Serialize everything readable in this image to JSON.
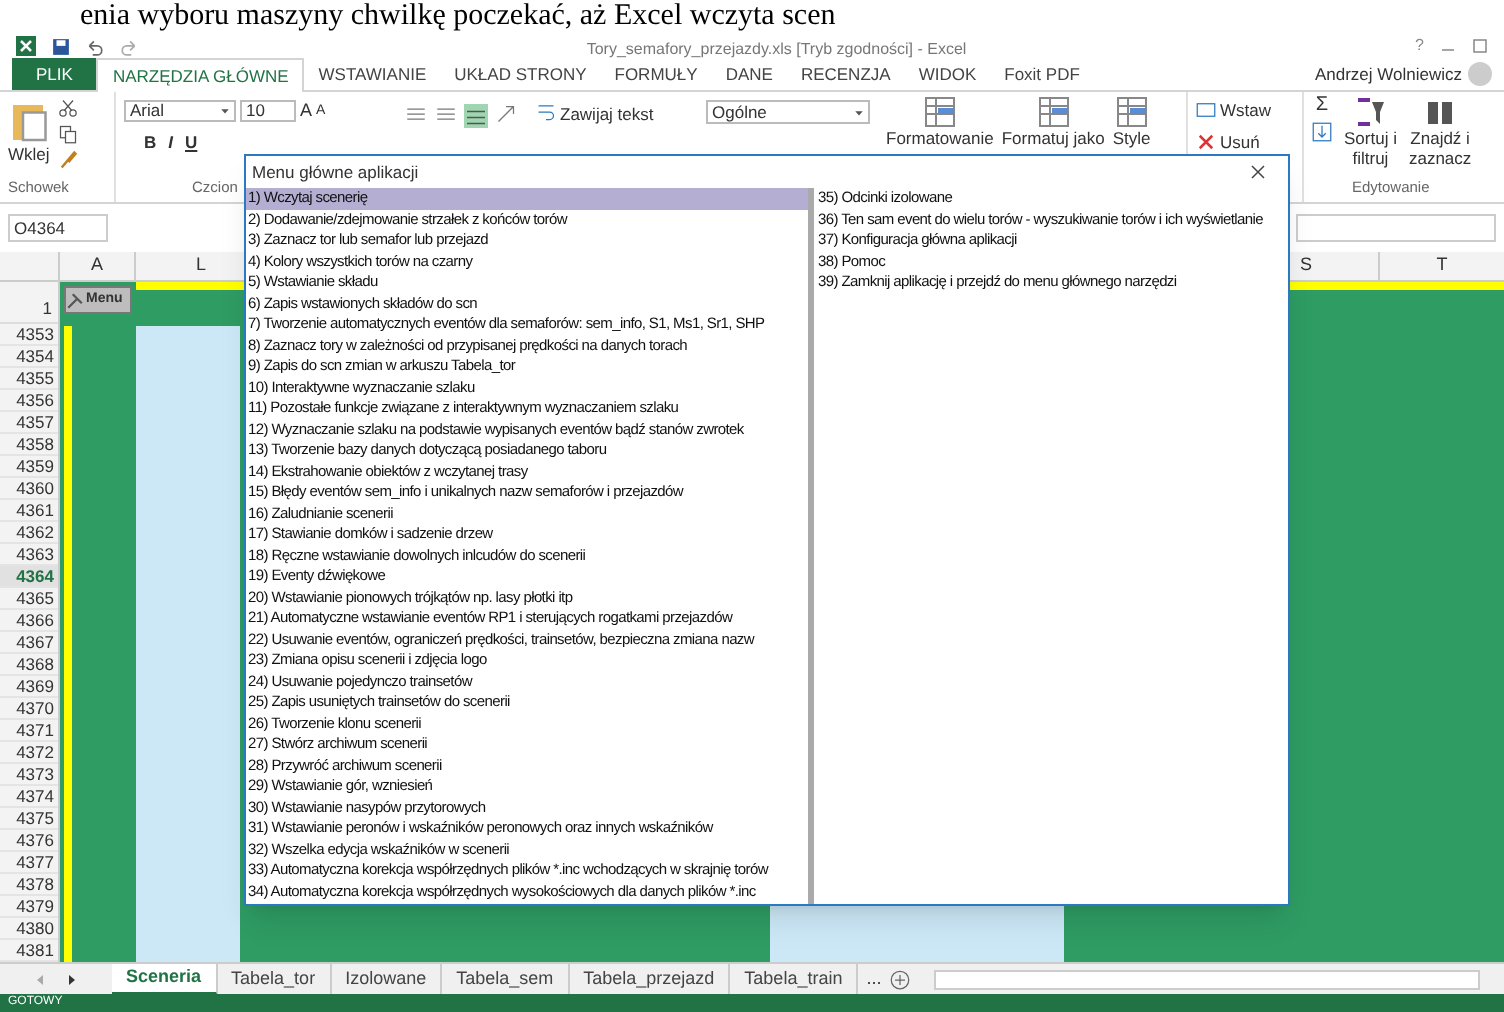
{
  "caption": "enia wyboru maszyny chwilkę poczekać, aż Excel wczyta scen",
  "window": {
    "title": "Tory_semafory_przejazdy.xls  [Tryb zgodności] - Excel",
    "user": "Andrzej Wolniewicz",
    "help": "?"
  },
  "ribbon_tabs": [
    {
      "label": "PLIK",
      "kind": "file",
      "selected": false
    },
    {
      "label": "NARZĘDZIA GŁÓWNE",
      "kind": "tab",
      "selected": true
    },
    {
      "label": "WSTAWIANIE",
      "kind": "tab",
      "selected": false
    },
    {
      "label": "UKŁAD STRONY",
      "kind": "tab",
      "selected": false
    },
    {
      "label": "FORMUŁY",
      "kind": "tab",
      "selected": false
    },
    {
      "label": "DANE",
      "kind": "tab",
      "selected": false
    },
    {
      "label": "RECENZJA",
      "kind": "tab",
      "selected": false
    },
    {
      "label": "WIDOK",
      "kind": "tab",
      "selected": false
    },
    {
      "label": "Foxit PDF",
      "kind": "tab",
      "selected": false
    }
  ],
  "ribbon": {
    "paste": "Wklej",
    "font_name": "Arial",
    "font_size": "10",
    "grow_font": "A",
    "shrink_font": "A",
    "sum": "Σ",
    "bold": "B",
    "italic": "I",
    "underline": "U",
    "wrap_text": "Zawijaj tekst",
    "number_format": "Ogólne",
    "styles": [
      "Formatowanie",
      "Formatuj jako",
      "Style"
    ],
    "insert": "Wstaw",
    "delete": "Usuń",
    "sort": [
      "Sortuj i",
      "filtruj"
    ],
    "find": [
      "Znajdź i",
      "zaznacz"
    ],
    "groups": [
      "Schowek",
      "Czcion",
      "Edytowanie"
    ]
  },
  "name_box": "O4364",
  "columns": [
    "A",
    "L",
    "S",
    "T"
  ],
  "menu_button": "Menu",
  "header_row": "1",
  "rows": [
    {
      "label": "4353",
      "selected": false
    },
    {
      "label": "4354",
      "selected": false
    },
    {
      "label": "4355",
      "selected": false
    },
    {
      "label": "4356",
      "selected": false
    },
    {
      "label": "4357",
      "selected": false
    },
    {
      "label": "4358",
      "selected": false
    },
    {
      "label": "4359",
      "selected": false
    },
    {
      "label": "4360",
      "selected": false
    },
    {
      "label": "4361",
      "selected": false
    },
    {
      "label": "4362",
      "selected": false
    },
    {
      "label": "4363",
      "selected": false
    },
    {
      "label": "4364",
      "selected": true
    },
    {
      "label": "4365",
      "selected": false
    },
    {
      "label": "4366",
      "selected": false
    },
    {
      "label": "4367",
      "selected": false
    },
    {
      "label": "4368",
      "selected": false
    },
    {
      "label": "4369",
      "selected": false
    },
    {
      "label": "4370",
      "selected": false
    },
    {
      "label": "4371",
      "selected": false
    },
    {
      "label": "4372",
      "selected": false
    },
    {
      "label": "4373",
      "selected": false
    },
    {
      "label": "4374",
      "selected": false
    },
    {
      "label": "4375",
      "selected": false
    },
    {
      "label": "4376",
      "selected": false
    },
    {
      "label": "4377",
      "selected": false
    },
    {
      "label": "4378",
      "selected": false
    },
    {
      "label": "4379",
      "selected": false
    },
    {
      "label": "4380",
      "selected": false
    },
    {
      "label": "4381",
      "selected": false
    }
  ],
  "dialog": {
    "title": "Menu główne aplikacji",
    "left_items": [
      {
        "label": "1) Wczytaj scenerię",
        "selected": true
      },
      {
        "label": "2) Dodawanie/zdejmowanie strzałek z końców torów",
        "selected": false
      },
      {
        "label": "3) Zaznacz tor lub semafor lub przejazd",
        "selected": false
      },
      {
        "label": "4) Kolory wszystkich torów na czarny",
        "selected": false
      },
      {
        "label": "5) Wstawianie składu",
        "selected": false
      },
      {
        "label": "6) Zapis wstawionych składów do scn",
        "selected": false
      },
      {
        "label": "7) Tworzenie automatycznych eventów dla semaforów: sem_info, S1, Ms1, Sr1, SHP",
        "selected": false
      },
      {
        "label": "8) Zaznacz tory w zależności od przypisanej prędkości na danych torach",
        "selected": false
      },
      {
        "label": "9) Zapis do scn zmian w arkuszu Tabela_tor",
        "selected": false
      },
      {
        "label": "10) Interaktywne wyznaczanie szlaku",
        "selected": false
      },
      {
        "label": "11) Pozostałe funkcje związane z interaktywnym wyznaczaniem szlaku",
        "selected": false
      },
      {
        "label": "12) Wyznaczanie szlaku na podstawie wypisanych eventów bądź stanów zwrotek",
        "selected": false
      },
      {
        "label": "13) Tworzenie bazy danych dotyczącą posiadanego taboru",
        "selected": false
      },
      {
        "label": "14) Ekstrahowanie obiektów z wczytanej trasy",
        "selected": false
      },
      {
        "label": "15) Błędy eventów sem_info i unikalnych nazw semaforów i przejazdów",
        "selected": false
      },
      {
        "label": "16) Zaludnianie scenerii",
        "selected": false
      },
      {
        "label": "17) Stawianie domków i sadzenie drzew",
        "selected": false
      },
      {
        "label": "18) Ręczne wstawianie dowolnych inlcudów do scenerii",
        "selected": false
      },
      {
        "label": "19) Eventy dźwiękowe",
        "selected": false
      },
      {
        "label": "20) Wstawianie pionowych trójkątów np. lasy płotki itp",
        "selected": false
      },
      {
        "label": "21) Automatyczne wstawianie eventów RP1 i sterujących rogatkami przejazdów",
        "selected": false
      },
      {
        "label": "22) Usuwanie eventów, ograniczeń prędkości, trainsetów, bezpieczna zmiana nazw",
        "selected": false
      },
      {
        "label": "23) Zmiana opisu scenerii i zdjęcia logo",
        "selected": false
      },
      {
        "label": "24) Usuwanie pojedynczo trainsetów",
        "selected": false
      },
      {
        "label": "25) Zapis usuniętych trainsetów do scenerii",
        "selected": false
      },
      {
        "label": "26) Tworzenie klonu scenerii",
        "selected": false
      },
      {
        "label": "27) Stwórz archiwum scenerii",
        "selected": false
      },
      {
        "label": "28) Przywróć archiwum scenerii",
        "selected": false
      },
      {
        "label": "29) Wstawianie gór, wzniesień",
        "selected": false
      },
      {
        "label": "30) Wstawianie nasypów przytorowych",
        "selected": false
      },
      {
        "label": "31) Wstawianie peronów i wskaźników peronowych oraz innych wskaźników",
        "selected": false
      },
      {
        "label": "32) Wszelka edycja wskaźników w scenerii",
        "selected": false
      },
      {
        "label": "33) Automatyczna korekcja współrzędnych plików *.inc wchodzących w skrajnię torów",
        "selected": false
      },
      {
        "label": "34) Automatyczna korekcja współrzędnych wysokościowych dla danych plików *.inc",
        "selected": false
      }
    ],
    "right_items": [
      {
        "label": "35) Odcinki izolowane",
        "selected": false
      },
      {
        "label": "36) Ten sam event do wielu torów - wyszukiwanie torów i ich wyświetlanie",
        "selected": false
      },
      {
        "label": "37) Konfiguracja główna aplikacji",
        "selected": false
      },
      {
        "label": "38) Pomoc",
        "selected": false
      },
      {
        "label": "39) Zamknij aplikację i przejdź do menu głównego narzędzi",
        "selected": false
      }
    ]
  },
  "sheet_tabs": [
    {
      "label": "Sceneria",
      "selected": true
    },
    {
      "label": "Tabela_tor",
      "selected": false
    },
    {
      "label": "Izolowane",
      "selected": false
    },
    {
      "label": "Tabela_sem",
      "selected": false
    },
    {
      "label": "Tabela_przejazd",
      "selected": false
    },
    {
      "label": "Tabela_train",
      "selected": false
    }
  ],
  "more_tabs": "...",
  "status": "GOTOWY"
}
